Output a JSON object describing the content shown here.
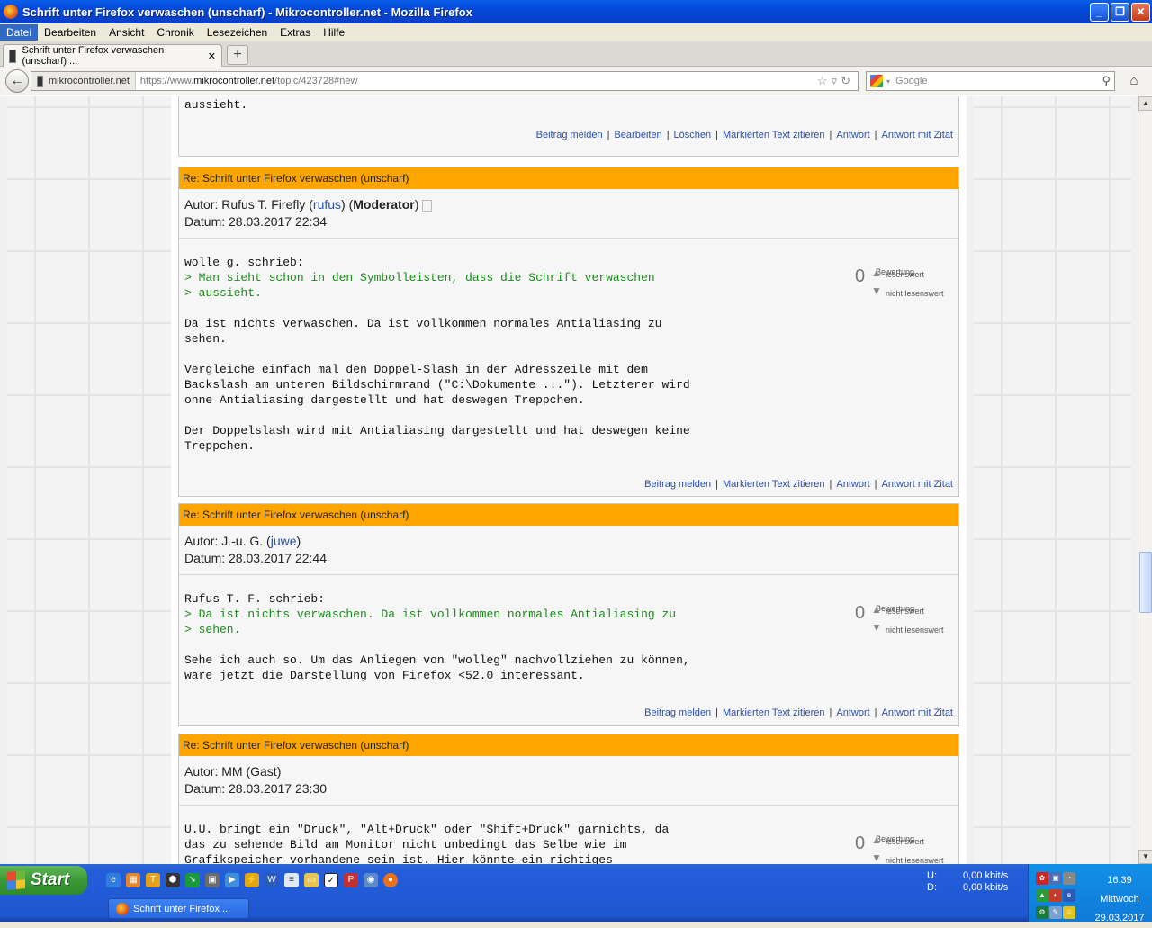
{
  "window": {
    "title": "Schrift unter Firefox verwaschen (unscharf) - Mikrocontroller.net - Mozilla Firefox",
    "controls": {
      "minimize": "_",
      "maximize": "❐",
      "close": "✕"
    }
  },
  "menu": [
    "Datei",
    "Bearbeiten",
    "Ansicht",
    "Chronik",
    "Lesezeichen",
    "Extras",
    "Hilfe"
  ],
  "tab": {
    "label": "Schrift unter Firefox verwaschen (unscharf) ...",
    "close": "✕",
    "new": "+"
  },
  "nav": {
    "identity": "mikrocontroller.net",
    "url_prefix": "https://www.",
    "url_domain": "mikrocontroller.net",
    "url_path": "/topic/423728#new",
    "search_placeholder": "Google"
  },
  "posts": [
    {
      "body_tail": "aussieht.",
      "actions": [
        "Beitrag melden",
        "Bearbeiten",
        "Löschen",
        "Markierten Text zitieren",
        "Antwort",
        "Antwort mit Zitat"
      ]
    },
    {
      "title": "Re: Schrift unter Firefox verwaschen (unscharf)",
      "author_label": "Autor:",
      "author": "Rufus T. Firefly",
      "nick": "rufus",
      "role": "Moderator",
      "date_label": "Datum:",
      "date": "28.03.2017 22:34",
      "quote_header": "wolle g. schrieb:",
      "quote_lines": [
        "> Man sieht schon in den Symbolleisten, dass die Schrift verwaschen",
        "> aussieht."
      ],
      "text": "Da ist nichts verwaschen. Da ist vollkommen normales Antialiasing zu\nsehen.\n\nVergleiche einfach mal den Doppel-Slash in der Adresszeile mit dem\nBackslash am unteren Bildschirmrand (\"C:\\Dokumente ...\"). Letzterer wird\nohne Antialiasing dargestellt und hat deswegen Treppchen.\n\nDer Doppelslash wird mit Antialiasing dargestellt und hat deswegen keine\nTreppchen.",
      "rating": {
        "label": "Bewertung",
        "score": "0",
        "up": "lesenswert",
        "down": "nicht lesenswert"
      },
      "actions": [
        "Beitrag melden",
        "Markierten Text zitieren",
        "Antwort",
        "Antwort mit Zitat"
      ]
    },
    {
      "title": "Re: Schrift unter Firefox verwaschen (unscharf)",
      "author_label": "Autor:",
      "author": "J.-u. G.",
      "nick": "juwe",
      "date_label": "Datum:",
      "date": "28.03.2017 22:44",
      "quote_header": "Rufus T. F. schrieb:",
      "quote_lines": [
        "> Da ist nichts verwaschen. Da ist vollkommen normales Antialiasing zu",
        "> sehen."
      ],
      "text": "Sehe ich auch so. Um das Anliegen von \"wolleg\" nachvollziehen zu können,\nwäre jetzt die Darstellung von Firefox <52.0 interessant.",
      "rating": {
        "label": "Bewertung",
        "score": "0",
        "up": "lesenswert",
        "down": "nicht lesenswert"
      },
      "actions": [
        "Beitrag melden",
        "Markierten Text zitieren",
        "Antwort",
        "Antwort mit Zitat"
      ]
    },
    {
      "title": "Re: Schrift unter Firefox verwaschen (unscharf)",
      "author_label": "Autor:",
      "author": "MM (Gast)",
      "date_label": "Datum:",
      "date": "28.03.2017 23:30",
      "text": "U.U. bringt ein \"Druck\", \"Alt+Druck\" oder \"Shift+Druck\" garnichts, da\ndas zu sehende Bild am Monitor nicht unbedingt das Selbe wie im\nGrafikspeicher vorhandene sein ist. Hier könnte ein richtiges",
      "rating": {
        "label": "Bewertung",
        "score": "0",
        "up": "lesenswert",
        "down": "nicht lesenswert"
      }
    }
  ],
  "taskbar": {
    "start": "Start",
    "task": "Schrift unter Firefox ...",
    "net_u_label": "U:",
    "net_u": "0,00 kbit/s",
    "net_d_label": "D:",
    "net_d": "0,00 kbit/s",
    "time": "16:39",
    "weekday": "Mittwoch",
    "date": "29.03.2017"
  }
}
